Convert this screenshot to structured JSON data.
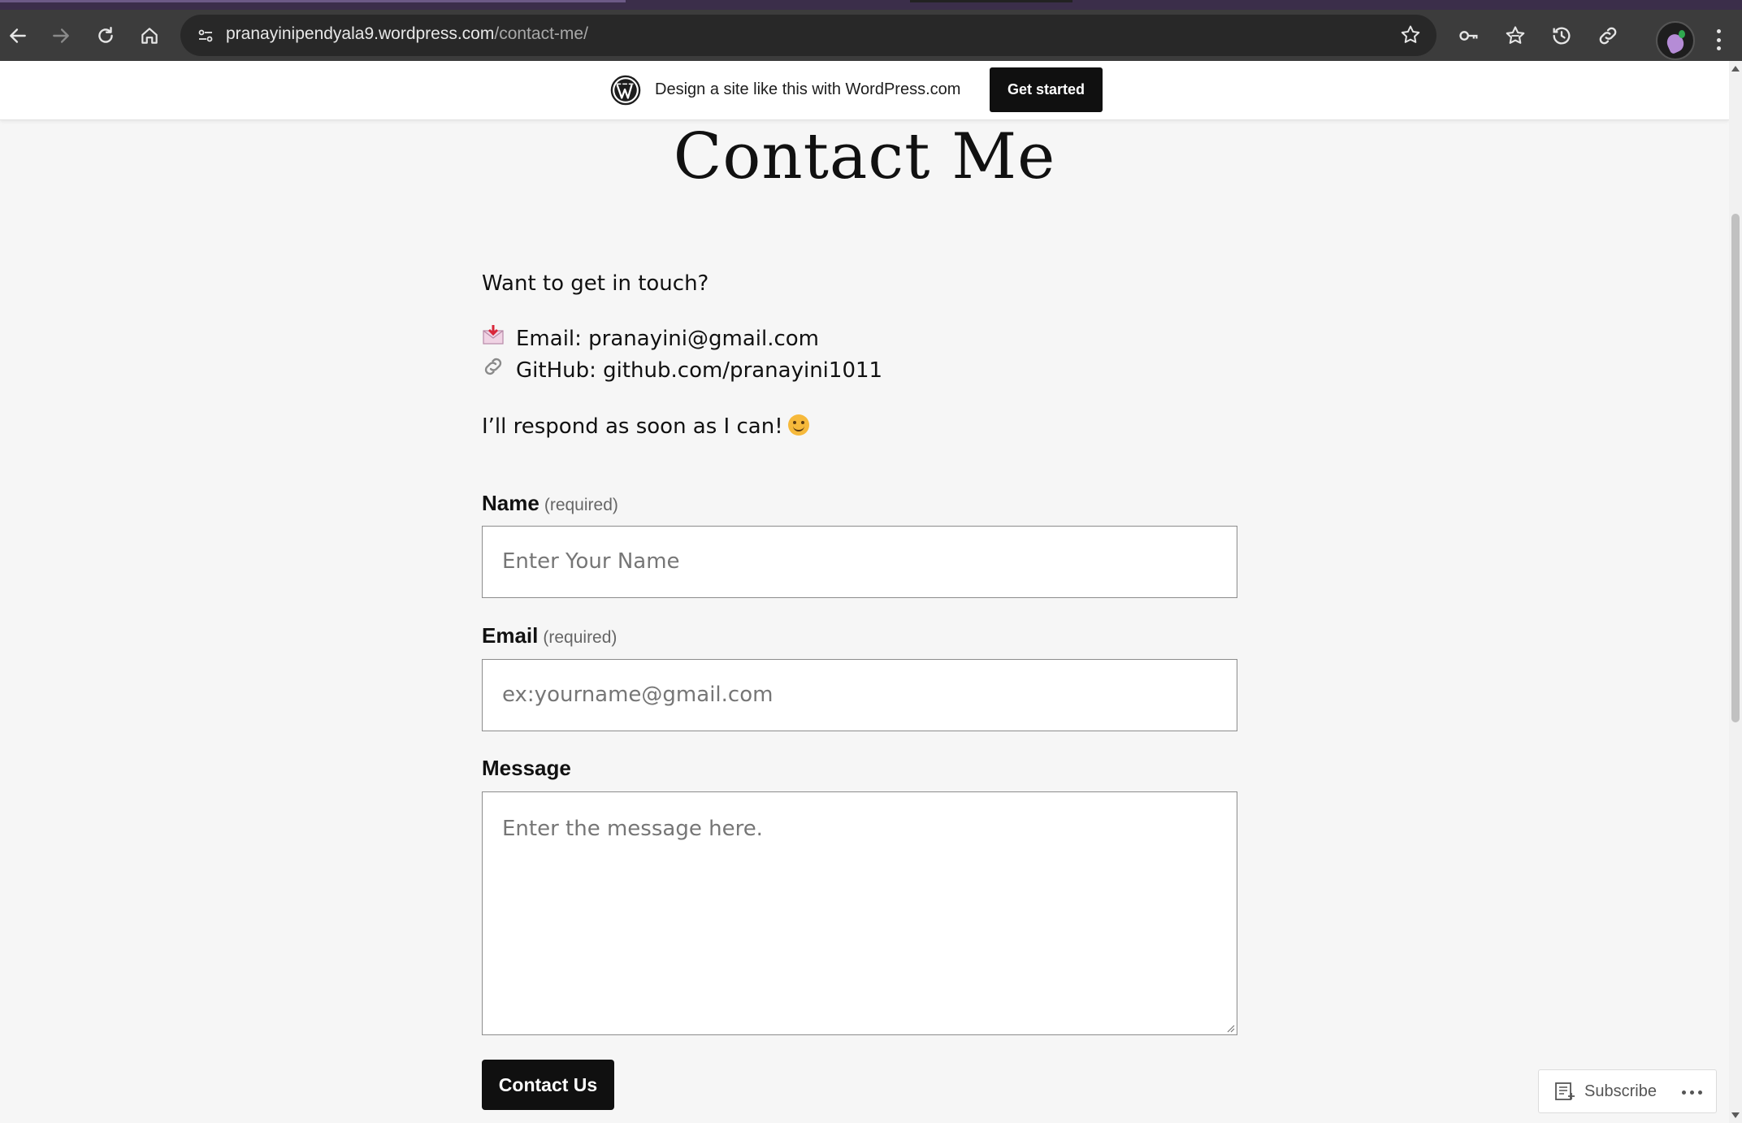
{
  "browser": {
    "url_host": "pranayinipendyala9.wordpress.com",
    "url_path": "/contact-me/",
    "icons": [
      "back-icon",
      "forward-icon",
      "reload-icon",
      "home-icon",
      "site-info-icon",
      "bookmark-star-icon",
      "password-key-icon",
      "favorites-icon",
      "history-icon",
      "link-icon",
      "profile-avatar",
      "menu-icon"
    ]
  },
  "banner": {
    "text": "Design a site like this with WordPress.com",
    "cta": "Get started"
  },
  "page": {
    "title": "Contact Me",
    "intro": "Want to get in touch?",
    "email_line": "Email: pranayini@gmail.com",
    "github_line": "GitHub: github.com/pranayini1011",
    "respond": "I’ll respond as soon as I can!"
  },
  "form": {
    "name_label": "Name",
    "name_required": "(required)",
    "name_placeholder": "Enter Your Name",
    "email_label": "Email",
    "email_required": "(required)",
    "email_placeholder": "ex:yourname@gmail.com",
    "message_label": "Message",
    "message_placeholder": "Enter the message here.",
    "submit": "Contact Us"
  },
  "subscribe": {
    "label": "Subscribe"
  },
  "colors": {
    "chrome_toolbar": "#3c3c3c",
    "page_background": "#f6f6f6",
    "button_dark": "#101010"
  }
}
